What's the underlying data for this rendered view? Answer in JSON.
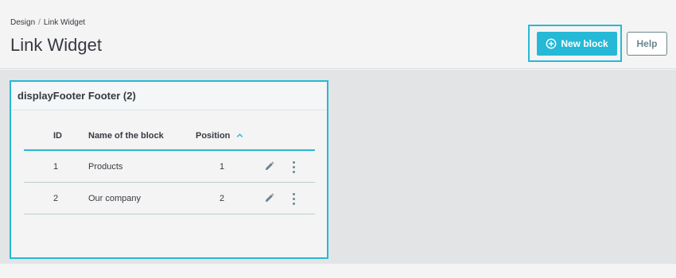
{
  "breadcrumb": {
    "parent": "Design",
    "separator": "/",
    "current": "Link Widget"
  },
  "page_title": "Link Widget",
  "toolbar": {
    "new_block_label": "New block",
    "help_label": "Help"
  },
  "card": {
    "title": "displayFooter Footer (2)",
    "columns": {
      "id": "ID",
      "name": "Name of the block",
      "position": "Position"
    },
    "rows": [
      {
        "id": "1",
        "name": "Products",
        "position": "1"
      },
      {
        "id": "2",
        "name": "Our company",
        "position": "2"
      }
    ]
  },
  "colors": {
    "accent": "#25b9d7",
    "text": "#363a41",
    "muted": "#6c868e"
  }
}
